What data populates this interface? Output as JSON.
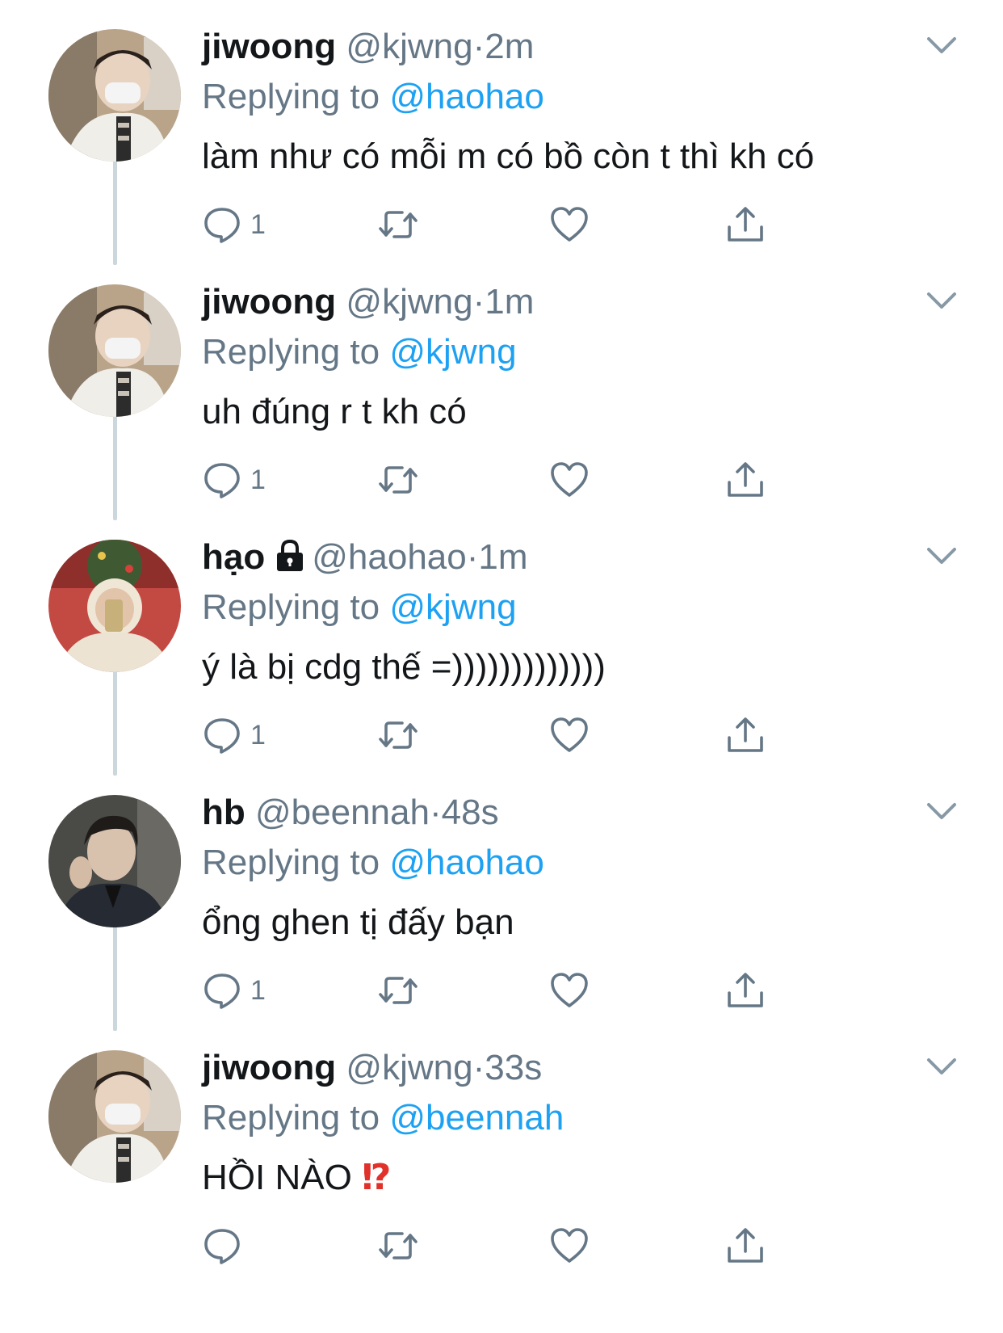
{
  "tweets": [
    {
      "name": "jiwoong",
      "handle": "@kjwng",
      "dot": "·",
      "time": "2m",
      "reply_prefix": "Replying to",
      "reply_to": "@haohao",
      "text": "làm như có mỗi m có bồ còn t thì kh có",
      "reply_count": "1",
      "avatar": "jiwoong-avatar"
    },
    {
      "name": "jiwoong",
      "handle": "@kjwng",
      "dot": "·",
      "time": "1m",
      "reply_prefix": "Replying to",
      "reply_to": "@kjwng",
      "text": "uh đúng r t kh có",
      "reply_count": "1",
      "avatar": "jiwoong-avatar"
    },
    {
      "name": "hạo",
      "handle": "@haohao",
      "dot": "·",
      "time": "1m",
      "reply_prefix": "Replying to",
      "reply_to": "@kjwng",
      "text": "ý là bị cdg thế =)))))))))))))",
      "reply_count": "1",
      "avatar": "hao-avatar",
      "protected_icon": "lock-icon"
    },
    {
      "name": "hb",
      "handle": "@beennah",
      "dot": "·",
      "time": "48s",
      "reply_prefix": "Replying to",
      "reply_to": "@haohao",
      "text": "ổng ghen tị đấy bạn",
      "reply_count": "1",
      "avatar": "hb-avatar"
    },
    {
      "name": "jiwoong",
      "handle": "@kjwng",
      "dot": "·",
      "time": "33s",
      "reply_prefix": "Replying to",
      "reply_to": "@beennah",
      "text": "HỒI NÀO",
      "text_emoji": "⁉",
      "reply_count": "",
      "avatar": "jiwoong-avatar"
    }
  ],
  "colors": {
    "name": "#14171a",
    "secondary": "#657786",
    "mention": "#1da1f2",
    "thread_line": "#ccd6dd",
    "emoji": "#e0312b"
  },
  "icons": {
    "reply": "speech-bubble-icon",
    "retweet": "retweet-icon",
    "like": "heart-icon",
    "share": "share-icon",
    "menu": "chevron-down-icon"
  }
}
